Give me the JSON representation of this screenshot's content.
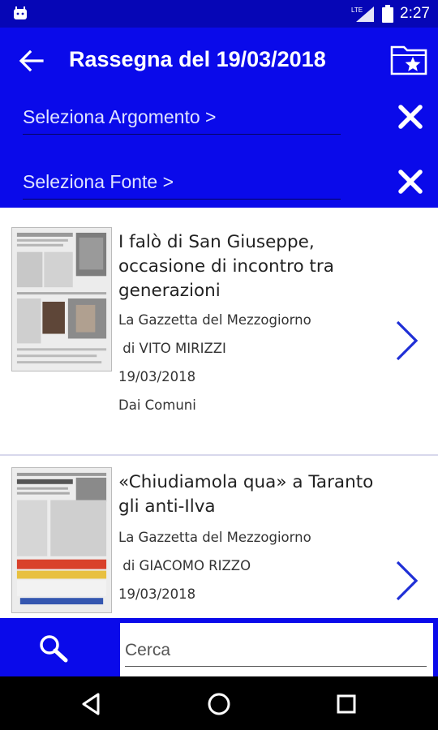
{
  "status_bar": {
    "network": "LTE",
    "time": "2:27"
  },
  "header": {
    "title": "Rassegna del 19/03/2018",
    "back_icon": "arrow-back-icon",
    "folder_icon": "folder-star-icon",
    "filters": [
      {
        "label": "Seleziona Argomento >"
      },
      {
        "label": "Seleziona Fonte >"
      }
    ]
  },
  "articles": [
    {
      "headline": "I falò di San Giuseppe, occasione di incontro tra generazioni",
      "source": "La Gazzetta del Mezzogiorno",
      "author": " di VITO MIRIZZI",
      "date": "19/03/2018",
      "section": "Dai Comuni"
    },
    {
      "headline": "«Chiudiamola qua» a Taranto gli anti-Ilva",
      "source": "La Gazzetta del Mezzogiorno",
      "author": " di GIACOMO RIZZO",
      "date": "19/03/2018"
    }
  ],
  "search": {
    "placeholder": "Cerca",
    "value": ""
  },
  "colors": {
    "app_bar": "#0a0aea",
    "status_bar": "#0606b6",
    "accent": "#1f2fd6"
  }
}
